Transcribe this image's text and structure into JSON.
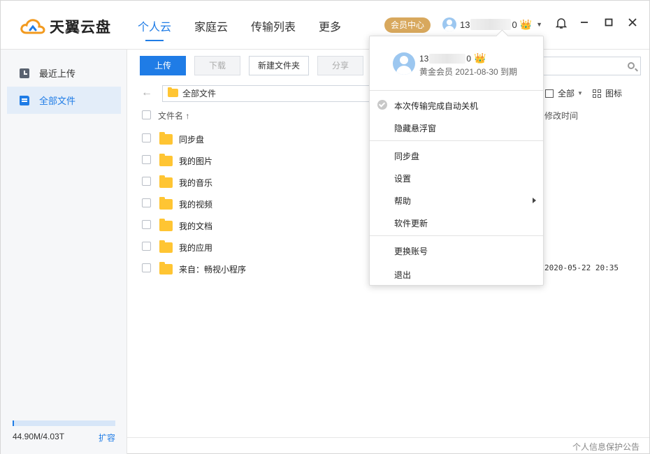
{
  "app": {
    "logo_text": "天翼云盘",
    "brand_color": "#1f7ce6",
    "vip_button": "会员中心",
    "user_prefix": "13",
    "user_suffix": "0",
    "user_crown": "👑"
  },
  "nav": {
    "items": [
      {
        "label": "个人云",
        "active": true
      },
      {
        "label": "家庭云",
        "active": false
      },
      {
        "label": "传输列表",
        "active": false
      },
      {
        "label": "更多",
        "active": false
      }
    ]
  },
  "sidebar": {
    "items": [
      {
        "label": "最近上传",
        "icon": "clock-icon"
      },
      {
        "label": "全部文件",
        "icon": "files-icon"
      }
    ],
    "storage_text": "44.90M/4.03T",
    "storage_used_fraction": 1.09e-05,
    "expand_label": "扩容"
  },
  "toolbar": {
    "upload": "上传",
    "download": "下载",
    "new_folder": "新建文件夹",
    "share": "分享"
  },
  "path": {
    "current": "全部文件",
    "filter_label": "全部",
    "view_label": "图标"
  },
  "list": {
    "header_name": "文件名 ↑",
    "header_time": "修改时间",
    "rows": [
      {
        "name": "同步盘",
        "time": ""
      },
      {
        "name": "我的图片",
        "time": ""
      },
      {
        "name": "我的音乐",
        "time": ""
      },
      {
        "name": "我的视频",
        "time": ""
      },
      {
        "name": "我的文档",
        "time": ""
      },
      {
        "name": "我的应用",
        "time": ""
      },
      {
        "name": "来自：畅视小程序",
        "time": "2020-05-22 20:35"
      }
    ]
  },
  "footer": {
    "privacy": "个人信息保护公告"
  },
  "dropdown": {
    "name_prefix": "13",
    "name_suffix": "0",
    "member_info": "黄金会员 2021-08-30 到期",
    "auto_shutdown": "本次传输完成自动关机",
    "hide_float": "隐藏悬浮窗",
    "sync_disk": "同步盘",
    "settings": "设置",
    "help": "帮助",
    "update": "软件更新",
    "switch_account": "更换账号",
    "exit": "退出"
  }
}
